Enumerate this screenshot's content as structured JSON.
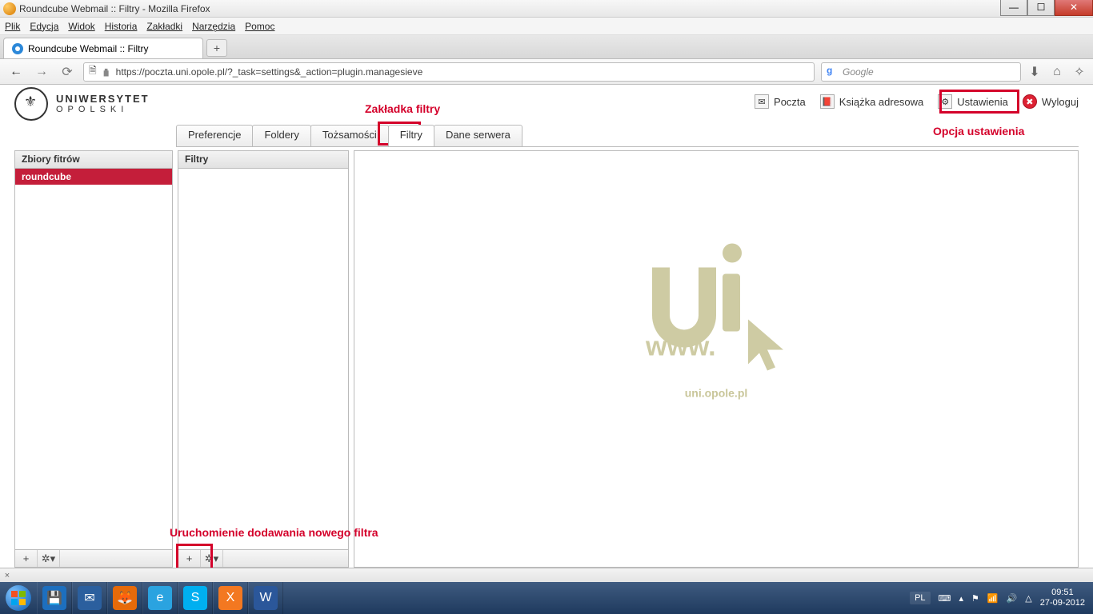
{
  "window": {
    "title": "Roundcube Webmail :: Filtry - Mozilla Firefox"
  },
  "menubar": [
    "Plik",
    "Edycja",
    "Widok",
    "Historia",
    "Zakładki",
    "Narzędzia",
    "Pomoc"
  ],
  "browser_tab": {
    "title": "Roundcube Webmail :: Filtry"
  },
  "url": "https://poczta.uni.opole.pl/?_task=settings&_action=plugin.managesieve",
  "search": {
    "placeholder": "Google"
  },
  "logo": {
    "line1": "UNIWERSYTET",
    "line2": "OPOLSKI"
  },
  "top_links": {
    "mail": "Poczta",
    "addressbook": "Książka adresowa",
    "settings": "Ustawienia",
    "logout": "Wyloguj"
  },
  "tabs": [
    "Preferencje",
    "Foldery",
    "Tożsamości",
    "Filtry",
    "Dane serwera"
  ],
  "active_tab_index": 3,
  "panels": {
    "sets_header": "Zbiory fitrów",
    "filters_header": "Filtry",
    "sets": [
      "roundcube"
    ]
  },
  "watermark_url": "uni.opole.pl",
  "annotations": {
    "tab_filtry": "Zakładka filtry",
    "opcja_ustawienia": "Opcja ustawienia",
    "add_filter": "Uruchomienie dodawania nowego filtra"
  },
  "systray": {
    "lang": "PL",
    "time": "09:51",
    "date": "27-09-2012"
  }
}
